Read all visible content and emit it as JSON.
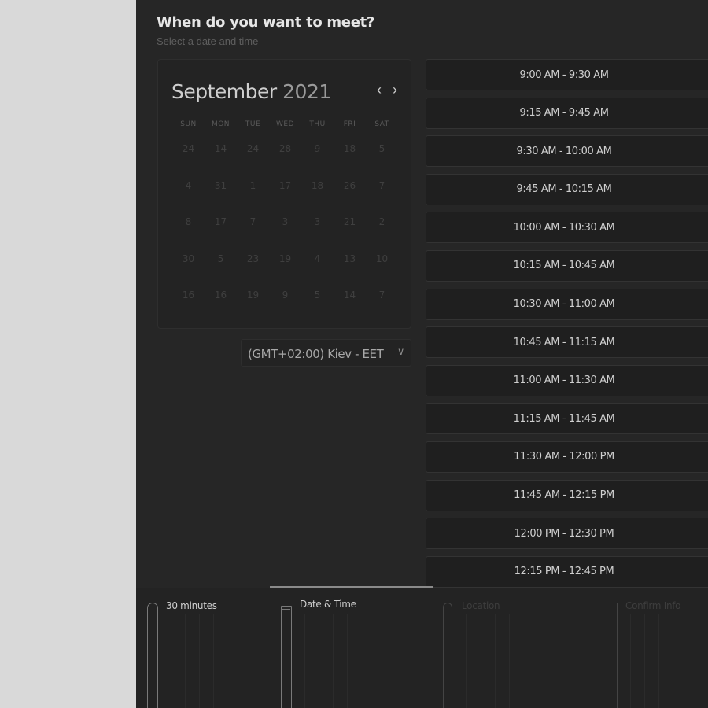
{
  "header": {
    "title": "When do you want to meet?",
    "subtitle": "Select a date and time"
  },
  "calendar": {
    "month": "September",
    "year": "2021",
    "prev_icon": "‹",
    "next_icon": "›",
    "weekdays": [
      "SUN",
      "MON",
      "TUE",
      "WED",
      "THU",
      "FRI",
      "SAT"
    ],
    "weeks": [
      [
        "24",
        "14",
        "24",
        "28",
        "9",
        "18",
        "5"
      ],
      [
        "4",
        "31",
        "1",
        "17",
        "18",
        "26",
        "7"
      ],
      [
        "8",
        "17",
        "7",
        "3",
        "3",
        "21",
        "2"
      ],
      [
        "30",
        "5",
        "23",
        "19",
        "4",
        "13",
        "10"
      ],
      [
        "16",
        "16",
        "19",
        "9",
        "5",
        "14",
        "7"
      ]
    ]
  },
  "timezone": {
    "selected": "(GMT+02:00) Kiev - EET",
    "chevron": "∨"
  },
  "slots": [
    "9:00 AM - 9:30 AM",
    "9:15 AM - 9:45 AM",
    "9:30 AM - 10:00 AM",
    "9:45 AM - 10:15 AM",
    "10:00 AM - 10:30 AM",
    "10:15 AM - 10:45 AM",
    "10:30 AM - 11:00 AM",
    "10:45 AM - 11:15 AM",
    "11:00 AM - 11:30 AM",
    "11:15 AM - 11:45 AM",
    "11:30 AM - 12:00 PM",
    "11:45 AM - 12:15 PM",
    "12:00 PM - 12:30 PM",
    "12:15 PM - 12:45 PM"
  ],
  "steps": [
    {
      "label": "30 minutes",
      "icon": "clock-icon",
      "state": "done"
    },
    {
      "label": "Date & Time",
      "icon": "calendar-icon",
      "state": "active"
    },
    {
      "label": "Location",
      "icon": "location-pin-icon",
      "state": "pending"
    },
    {
      "label": "Confirm Info",
      "icon": "document-icon",
      "state": "pending"
    }
  ]
}
